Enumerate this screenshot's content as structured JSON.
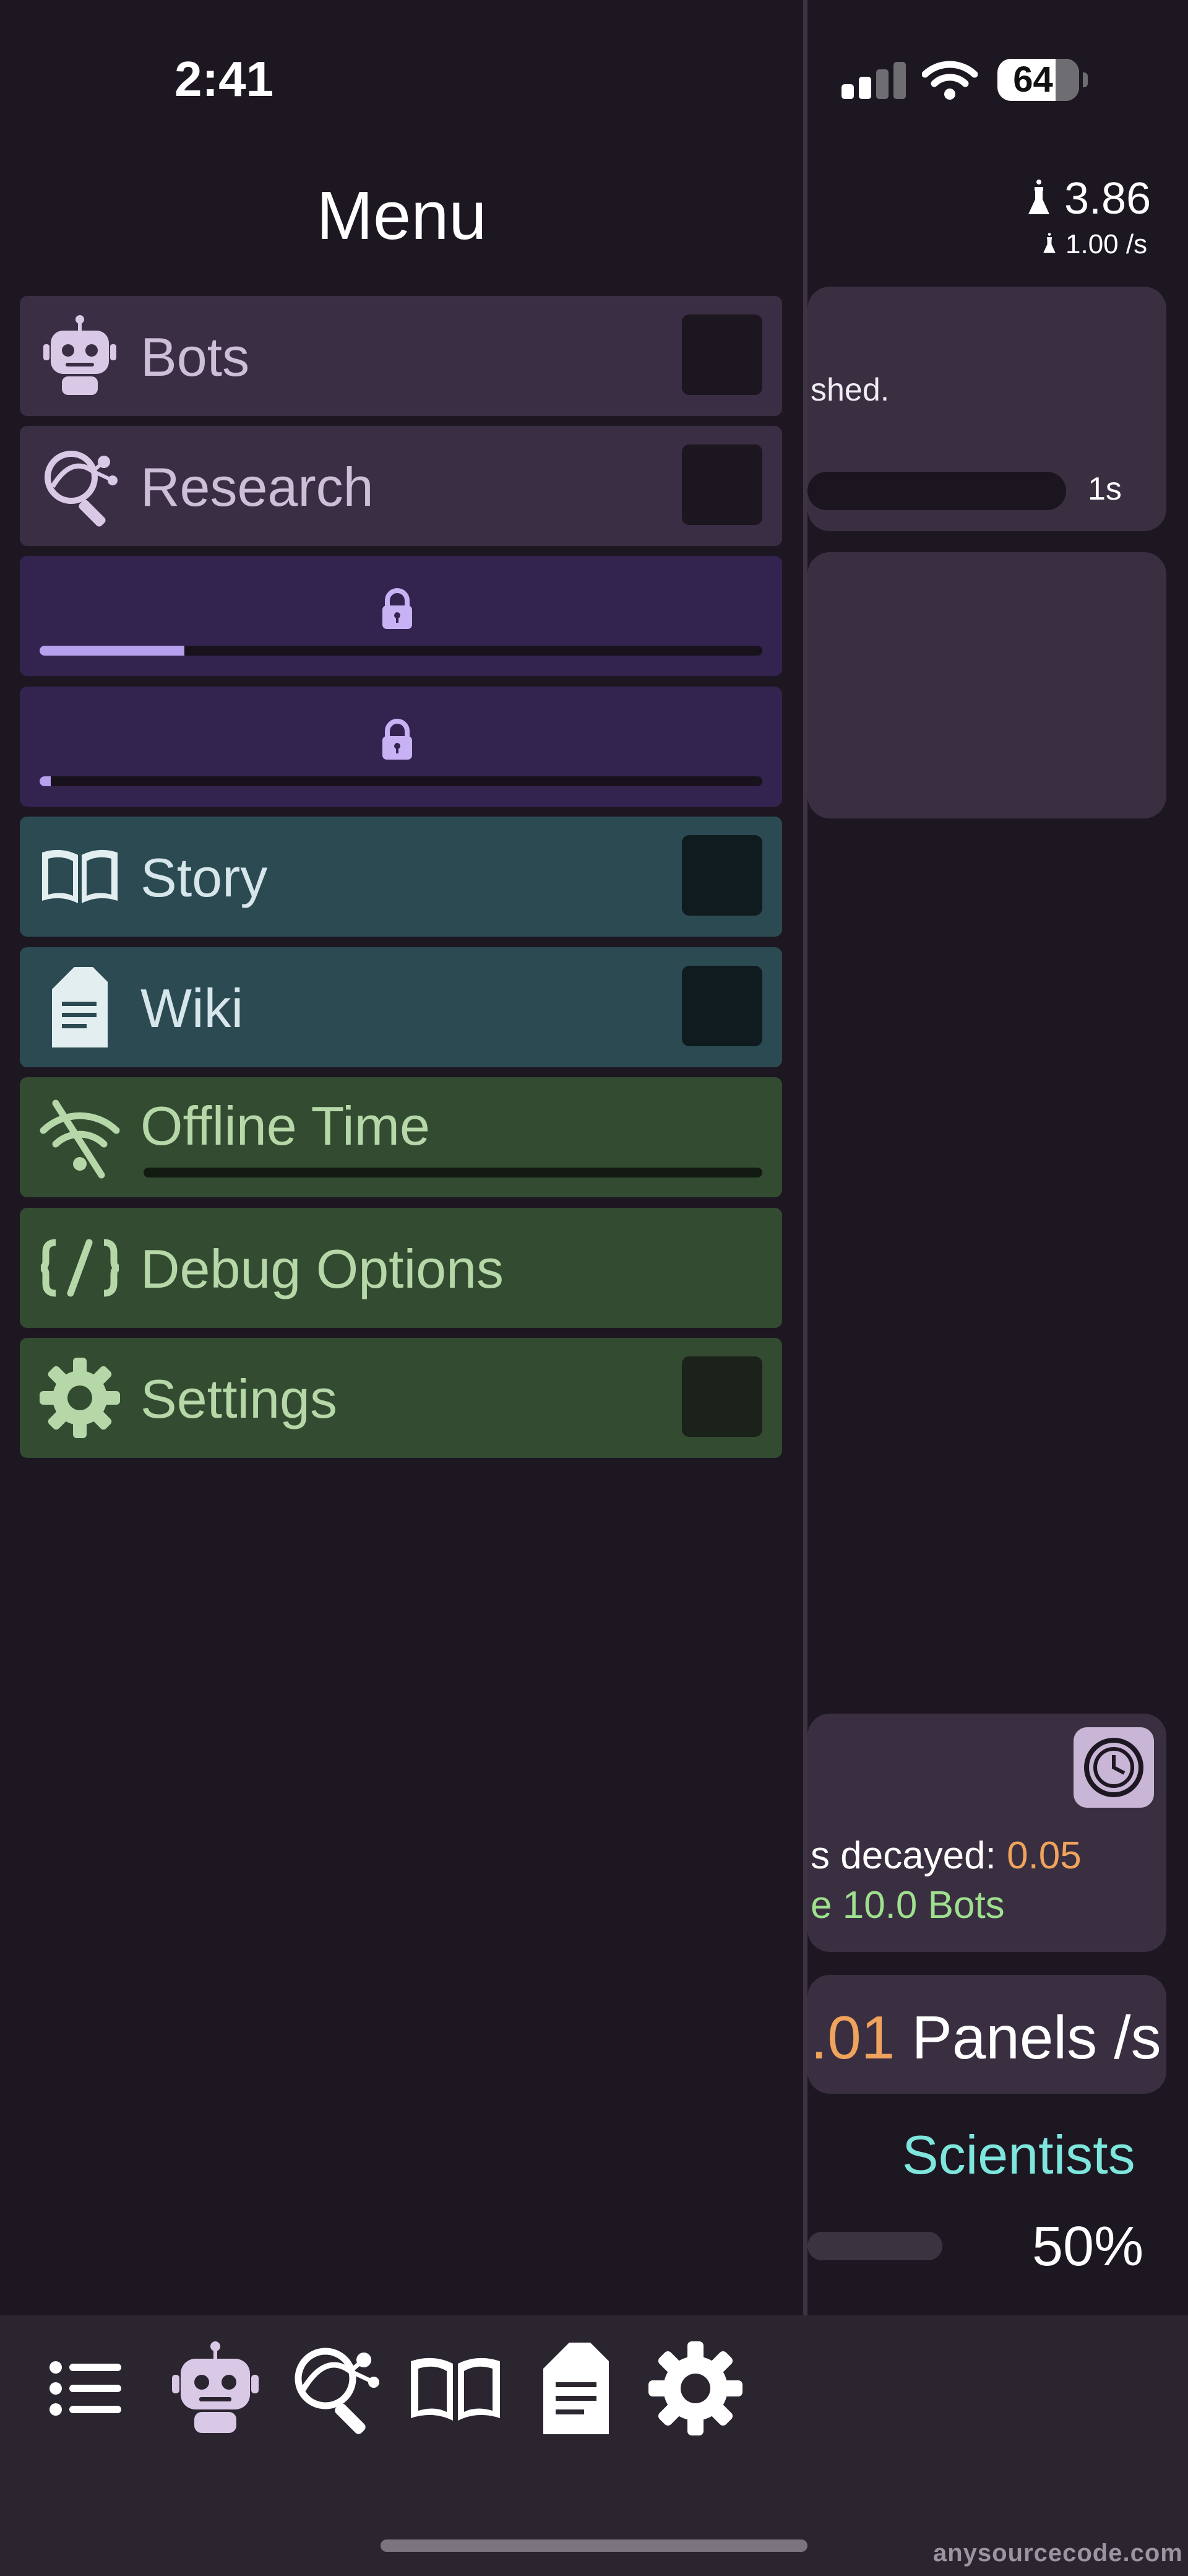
{
  "status_bar": {
    "time": "2:41",
    "battery": "64"
  },
  "menu": {
    "title": "Menu",
    "items": [
      {
        "label": "Bots",
        "icon": "robot-icon"
      },
      {
        "label": "Research",
        "icon": "research-icon"
      },
      {
        "label": "",
        "icon": "lock-icon",
        "progress": 0.2
      },
      {
        "label": "",
        "icon": "lock-icon",
        "progress": 0.015
      },
      {
        "label": "Story",
        "icon": "book-icon"
      },
      {
        "label": "Wiki",
        "icon": "document-icon"
      },
      {
        "label": "Offline Time",
        "icon": "wifi-off-icon"
      },
      {
        "label": "Debug Options",
        "icon": "code-icon"
      },
      {
        "label": "Settings",
        "icon": "gear-icon"
      }
    ]
  },
  "background": {
    "resource_amount": "3.86",
    "resource_rate": "1.00 /s",
    "card1_text": "shed.",
    "card1_timer": "1s",
    "decayed_label": "s decayed: ",
    "decayed_value": "0.05",
    "bots_text": "e 10.0 Bots",
    "panels_value": ".01",
    "panels_label": " Panels /s",
    "scientists_label": "Scientists",
    "scientists_percent": "50%"
  },
  "tab_bar": {
    "tabs": [
      "list-icon",
      "robot-icon",
      "research-icon",
      "book-icon",
      "document-icon",
      "gear-icon"
    ]
  },
  "watermark": "anysourcecode.com",
  "colors": {
    "purple_item": "#3a2e44",
    "locked_item": "#33234f",
    "teal_item": "#2b4a52",
    "green_item": "#334b31",
    "accent_orange": "#f0a35c",
    "accent_green": "#9ee08e",
    "accent_teal": "#7ee6dc"
  }
}
